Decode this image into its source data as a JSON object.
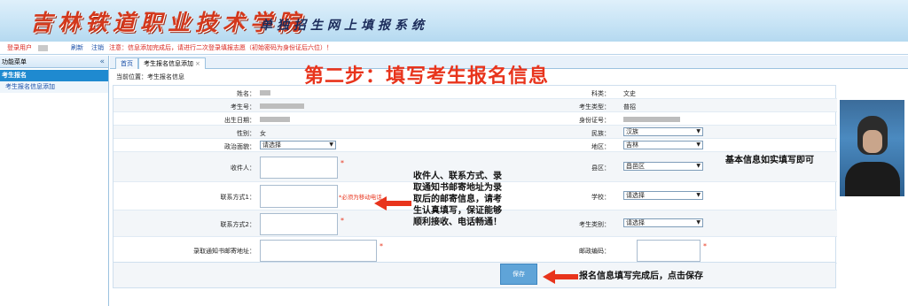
{
  "banner": {
    "title": "吉林铁道职业技术学院",
    "subtitle": "单独招生网上填报系统"
  },
  "statusbar": {
    "user_label": "登录用户",
    "refresh": "刷新",
    "logout": "注销",
    "notice": "注意：信息添加完成后，请进行二次登录填报志愿（初始密码为身份证后六位）！"
  },
  "sidebar": {
    "header": "功能菜单",
    "collapse": "«",
    "group": "考生报名",
    "items": [
      {
        "label": "考生报名信息添加"
      }
    ]
  },
  "tabs": [
    {
      "label": "首页"
    },
    {
      "label": "考生报名信息添加",
      "close": "×"
    }
  ],
  "breadcrumb": "当前位置：考生报名信息",
  "step_title": "第二步：填写考生报名信息",
  "form": {
    "name_label": "姓名：",
    "subject_label": "科类：",
    "subject_value": "文史",
    "exam_no_label": "考生号：",
    "exam_type_label": "考生类型：",
    "exam_type_value": "普招",
    "birth_label": "出生日期：",
    "id_label": "身份证号：",
    "gender_label": "性别：",
    "gender_value": "女",
    "ethnicity_label": "民族：",
    "ethnicity_value": "汉族",
    "politics_label": "政治面貌：",
    "politics_value": "请选择",
    "region_label": "地区：",
    "region_value": "吉林",
    "recipient_label": "收件人：",
    "county_label": "县区：",
    "county_value": "昌邑区",
    "contact1_label": "联系方式1：",
    "contact1_note": "*必须为移动电话",
    "school_label": "学校：",
    "school_value": "请选择",
    "contact2_label": "联系方式2：",
    "student_type_label": "考生类别：",
    "student_type_value": "请选择",
    "address_label": "录取通知书邮寄地址：",
    "postcode_label": "邮政编码：",
    "required_mark": "*"
  },
  "save_label": "保存",
  "annotations": {
    "basic_info": "基本信息如实填写即可",
    "contact_info": "收件人、联系方式、录取通知书邮寄地址为录取后的邮寄信息，请考生认真填写，保证能够顺利接收、电话畅通！",
    "save_hint": "报名信息填写完成后，点击保存"
  }
}
